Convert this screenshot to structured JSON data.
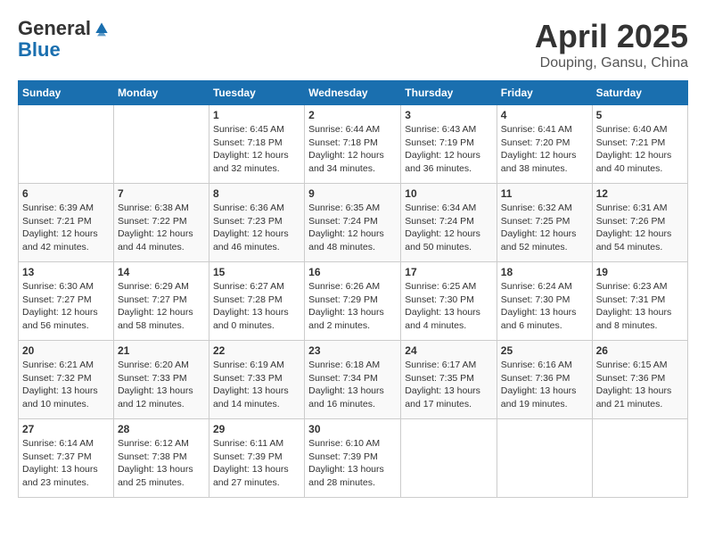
{
  "header": {
    "logo_general": "General",
    "logo_blue": "Blue",
    "month_title": "April 2025",
    "location": "Douping, Gansu, China"
  },
  "weekdays": [
    "Sunday",
    "Monday",
    "Tuesday",
    "Wednesday",
    "Thursday",
    "Friday",
    "Saturday"
  ],
  "weeks": [
    [
      {
        "day": "",
        "info": ""
      },
      {
        "day": "",
        "info": ""
      },
      {
        "day": "1",
        "info": "Sunrise: 6:45 AM\nSunset: 7:18 PM\nDaylight: 12 hours\nand 32 minutes."
      },
      {
        "day": "2",
        "info": "Sunrise: 6:44 AM\nSunset: 7:18 PM\nDaylight: 12 hours\nand 34 minutes."
      },
      {
        "day": "3",
        "info": "Sunrise: 6:43 AM\nSunset: 7:19 PM\nDaylight: 12 hours\nand 36 minutes."
      },
      {
        "day": "4",
        "info": "Sunrise: 6:41 AM\nSunset: 7:20 PM\nDaylight: 12 hours\nand 38 minutes."
      },
      {
        "day": "5",
        "info": "Sunrise: 6:40 AM\nSunset: 7:21 PM\nDaylight: 12 hours\nand 40 minutes."
      }
    ],
    [
      {
        "day": "6",
        "info": "Sunrise: 6:39 AM\nSunset: 7:21 PM\nDaylight: 12 hours\nand 42 minutes."
      },
      {
        "day": "7",
        "info": "Sunrise: 6:38 AM\nSunset: 7:22 PM\nDaylight: 12 hours\nand 44 minutes."
      },
      {
        "day": "8",
        "info": "Sunrise: 6:36 AM\nSunset: 7:23 PM\nDaylight: 12 hours\nand 46 minutes."
      },
      {
        "day": "9",
        "info": "Sunrise: 6:35 AM\nSunset: 7:24 PM\nDaylight: 12 hours\nand 48 minutes."
      },
      {
        "day": "10",
        "info": "Sunrise: 6:34 AM\nSunset: 7:24 PM\nDaylight: 12 hours\nand 50 minutes."
      },
      {
        "day": "11",
        "info": "Sunrise: 6:32 AM\nSunset: 7:25 PM\nDaylight: 12 hours\nand 52 minutes."
      },
      {
        "day": "12",
        "info": "Sunrise: 6:31 AM\nSunset: 7:26 PM\nDaylight: 12 hours\nand 54 minutes."
      }
    ],
    [
      {
        "day": "13",
        "info": "Sunrise: 6:30 AM\nSunset: 7:27 PM\nDaylight: 12 hours\nand 56 minutes."
      },
      {
        "day": "14",
        "info": "Sunrise: 6:29 AM\nSunset: 7:27 PM\nDaylight: 12 hours\nand 58 minutes."
      },
      {
        "day": "15",
        "info": "Sunrise: 6:27 AM\nSunset: 7:28 PM\nDaylight: 13 hours\nand 0 minutes."
      },
      {
        "day": "16",
        "info": "Sunrise: 6:26 AM\nSunset: 7:29 PM\nDaylight: 13 hours\nand 2 minutes."
      },
      {
        "day": "17",
        "info": "Sunrise: 6:25 AM\nSunset: 7:30 PM\nDaylight: 13 hours\nand 4 minutes."
      },
      {
        "day": "18",
        "info": "Sunrise: 6:24 AM\nSunset: 7:30 PM\nDaylight: 13 hours\nand 6 minutes."
      },
      {
        "day": "19",
        "info": "Sunrise: 6:23 AM\nSunset: 7:31 PM\nDaylight: 13 hours\nand 8 minutes."
      }
    ],
    [
      {
        "day": "20",
        "info": "Sunrise: 6:21 AM\nSunset: 7:32 PM\nDaylight: 13 hours\nand 10 minutes."
      },
      {
        "day": "21",
        "info": "Sunrise: 6:20 AM\nSunset: 7:33 PM\nDaylight: 13 hours\nand 12 minutes."
      },
      {
        "day": "22",
        "info": "Sunrise: 6:19 AM\nSunset: 7:33 PM\nDaylight: 13 hours\nand 14 minutes."
      },
      {
        "day": "23",
        "info": "Sunrise: 6:18 AM\nSunset: 7:34 PM\nDaylight: 13 hours\nand 16 minutes."
      },
      {
        "day": "24",
        "info": "Sunrise: 6:17 AM\nSunset: 7:35 PM\nDaylight: 13 hours\nand 17 minutes."
      },
      {
        "day": "25",
        "info": "Sunrise: 6:16 AM\nSunset: 7:36 PM\nDaylight: 13 hours\nand 19 minutes."
      },
      {
        "day": "26",
        "info": "Sunrise: 6:15 AM\nSunset: 7:36 PM\nDaylight: 13 hours\nand 21 minutes."
      }
    ],
    [
      {
        "day": "27",
        "info": "Sunrise: 6:14 AM\nSunset: 7:37 PM\nDaylight: 13 hours\nand 23 minutes."
      },
      {
        "day": "28",
        "info": "Sunrise: 6:12 AM\nSunset: 7:38 PM\nDaylight: 13 hours\nand 25 minutes."
      },
      {
        "day": "29",
        "info": "Sunrise: 6:11 AM\nSunset: 7:39 PM\nDaylight: 13 hours\nand 27 minutes."
      },
      {
        "day": "30",
        "info": "Sunrise: 6:10 AM\nSunset: 7:39 PM\nDaylight: 13 hours\nand 28 minutes."
      },
      {
        "day": "",
        "info": ""
      },
      {
        "day": "",
        "info": ""
      },
      {
        "day": "",
        "info": ""
      }
    ]
  ]
}
